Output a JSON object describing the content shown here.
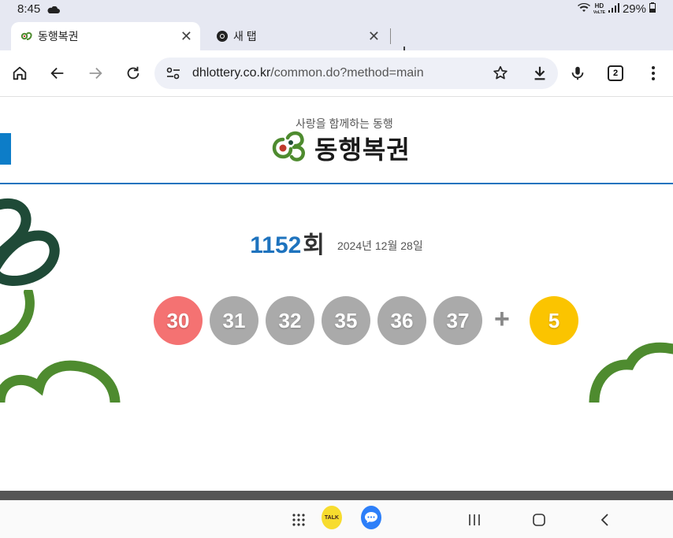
{
  "status_bar": {
    "time": "8:45",
    "hd_top": "HD",
    "hd_bottom": "VoLTE",
    "battery": "29%"
  },
  "tabs": [
    {
      "title": "동행복권",
      "active": true
    },
    {
      "title": "새 탭",
      "active": false
    }
  ],
  "toolbar": {
    "url_host": "dhlottery.co.kr",
    "url_path": "/common.do?method=main",
    "tab_count": "2"
  },
  "site": {
    "tagline": "사랑을 함께하는 동행",
    "brand": "동행복권"
  },
  "draw": {
    "number": "1152",
    "unit": "회",
    "date": "2024년 12월 28일"
  },
  "winning_numbers": [
    {
      "value": "30",
      "color": "#f47272"
    },
    {
      "value": "31",
      "color": "#aaaaaa"
    },
    {
      "value": "32",
      "color": "#aaaaaa"
    },
    {
      "value": "35",
      "color": "#aaaaaa"
    },
    {
      "value": "36",
      "color": "#aaaaaa"
    },
    {
      "value": "37",
      "color": "#aaaaaa"
    }
  ],
  "plus_sign": "+",
  "bonus_number": {
    "value": "5",
    "color": "#fbc400"
  },
  "nav_bar": {
    "kakao_label": "TALK"
  },
  "colors": {
    "brand_blue": "#1e73be",
    "brand_green": "#4e8b2f",
    "dark_green": "#1f4a37"
  }
}
